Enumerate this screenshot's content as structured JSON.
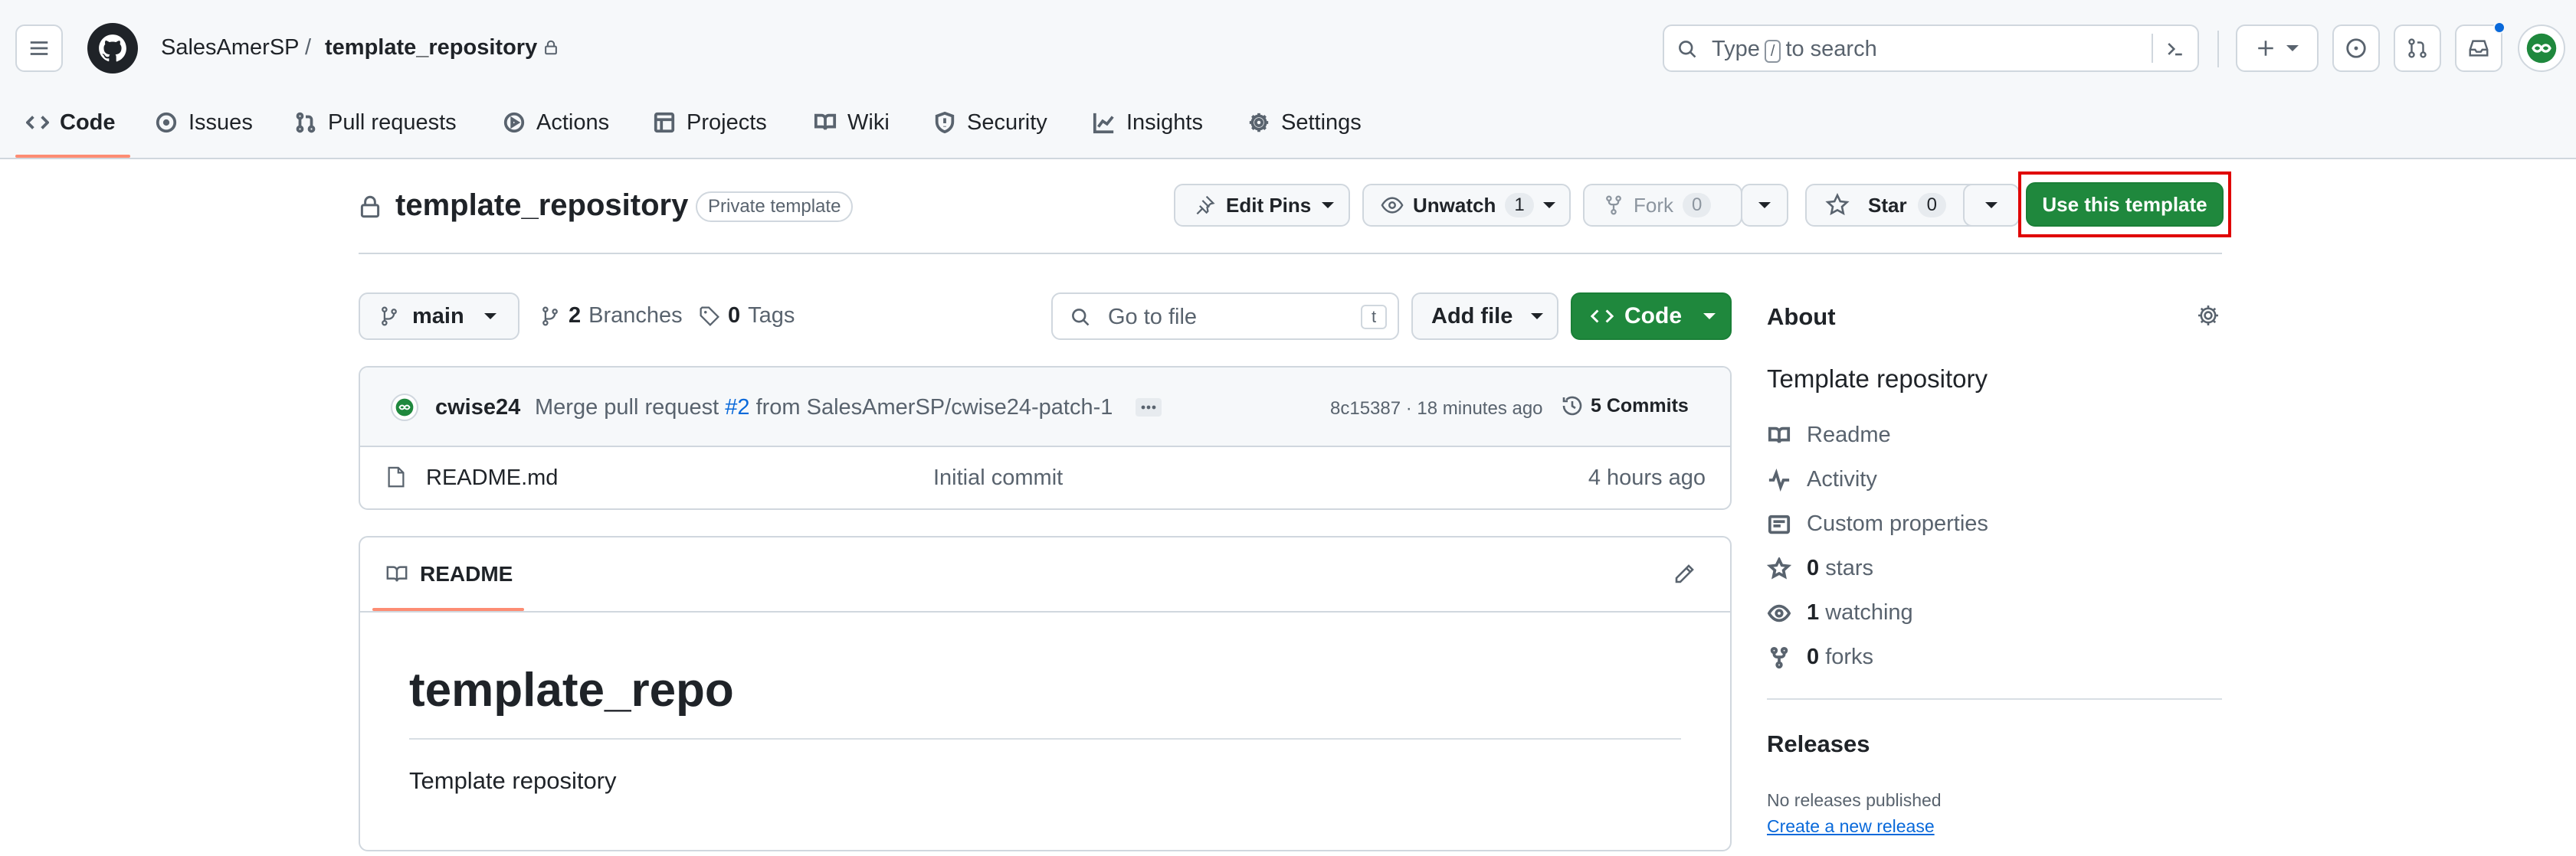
{
  "header": {
    "owner": "SalesAmerSP",
    "separator": "/",
    "repo": "template_repository",
    "search_prefix": "Type",
    "search_key": "/",
    "search_suffix": "to search"
  },
  "tabs": [
    {
      "label": "Code",
      "icon": "code-icon"
    },
    {
      "label": "Issues",
      "icon": "issue-icon"
    },
    {
      "label": "Pull requests",
      "icon": "pull-request-icon"
    },
    {
      "label": "Actions",
      "icon": "play-icon"
    },
    {
      "label": "Projects",
      "icon": "table-icon"
    },
    {
      "label": "Wiki",
      "icon": "book-icon"
    },
    {
      "label": "Security",
      "icon": "shield-icon"
    },
    {
      "label": "Insights",
      "icon": "graph-icon"
    },
    {
      "label": "Settings",
      "icon": "gear-icon"
    }
  ],
  "repo_head": {
    "name": "template_repository",
    "visibility_badge": "Private template",
    "edit_pins": "Edit Pins",
    "unwatch": "Unwatch",
    "watch_count": "1",
    "fork": "Fork",
    "fork_count": "0",
    "star": "Star",
    "star_count": "0",
    "use_template": "Use this template"
  },
  "file_nav": {
    "branch": "main",
    "branches_count": "2",
    "branches_label": "Branches",
    "tags_count": "0",
    "tags_label": "Tags",
    "go_to_file_placeholder": "Go to file",
    "go_to_file_key": "t",
    "add_file": "Add file",
    "code": "Code"
  },
  "latest_commit": {
    "author": "cwise24",
    "message_prefix": "Merge pull request",
    "pr_link": "#2",
    "message_suffix": "from SalesAmerSP/cwise24-patch-1",
    "hash_time": "8c15387 · 18 minutes ago",
    "commits_label": "5 Commits"
  },
  "files": [
    {
      "name": "README.md",
      "message": "Initial commit",
      "time": "4 hours ago"
    }
  ],
  "readme": {
    "tab_label": "README",
    "heading": "template_repo",
    "body": "Template repository"
  },
  "about": {
    "title": "About",
    "description": "Template repository",
    "readme": "Readme",
    "activity": "Activity",
    "custom_properties": "Custom properties",
    "stars_count": "0",
    "stars_label": "stars",
    "watching_count": "1",
    "watching_label": "watching",
    "forks_count": "0",
    "forks_label": "forks"
  },
  "releases": {
    "title": "Releases",
    "none": "No releases published",
    "create_link": "Create a new release"
  },
  "colors": {
    "accent_green": "#1f883d",
    "link_blue": "#0969da",
    "tab_underline": "#fd8c73",
    "highlight_red": "#e00000"
  }
}
